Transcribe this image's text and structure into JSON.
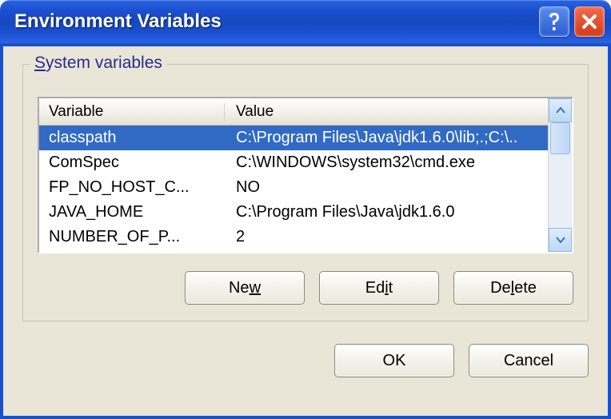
{
  "window": {
    "title": "Environment Variables"
  },
  "group": {
    "label": "System variables",
    "underline_char": "S"
  },
  "table": {
    "headers": {
      "variable": "Variable",
      "value": "Value"
    },
    "rows": [
      {
        "variable": "classpath",
        "value": "C:\\Program Files\\Java\\jdk1.6.0\\lib;.;C:\\..",
        "selected": true
      },
      {
        "variable": "ComSpec",
        "value": "C:\\WINDOWS\\system32\\cmd.exe"
      },
      {
        "variable": "FP_NO_HOST_C...",
        "value": "NO"
      },
      {
        "variable": "JAVA_HOME",
        "value": "C:\\Program Files\\Java\\jdk1.6.0"
      },
      {
        "variable": "NUMBER_OF_P...",
        "value": "2"
      }
    ]
  },
  "buttons": {
    "new": {
      "label": "New",
      "underline": "w"
    },
    "edit": {
      "label": "Edit",
      "underline": "i"
    },
    "delete": {
      "label": "Delete",
      "underline": "l"
    },
    "ok": "OK",
    "cancel": "Cancel"
  }
}
